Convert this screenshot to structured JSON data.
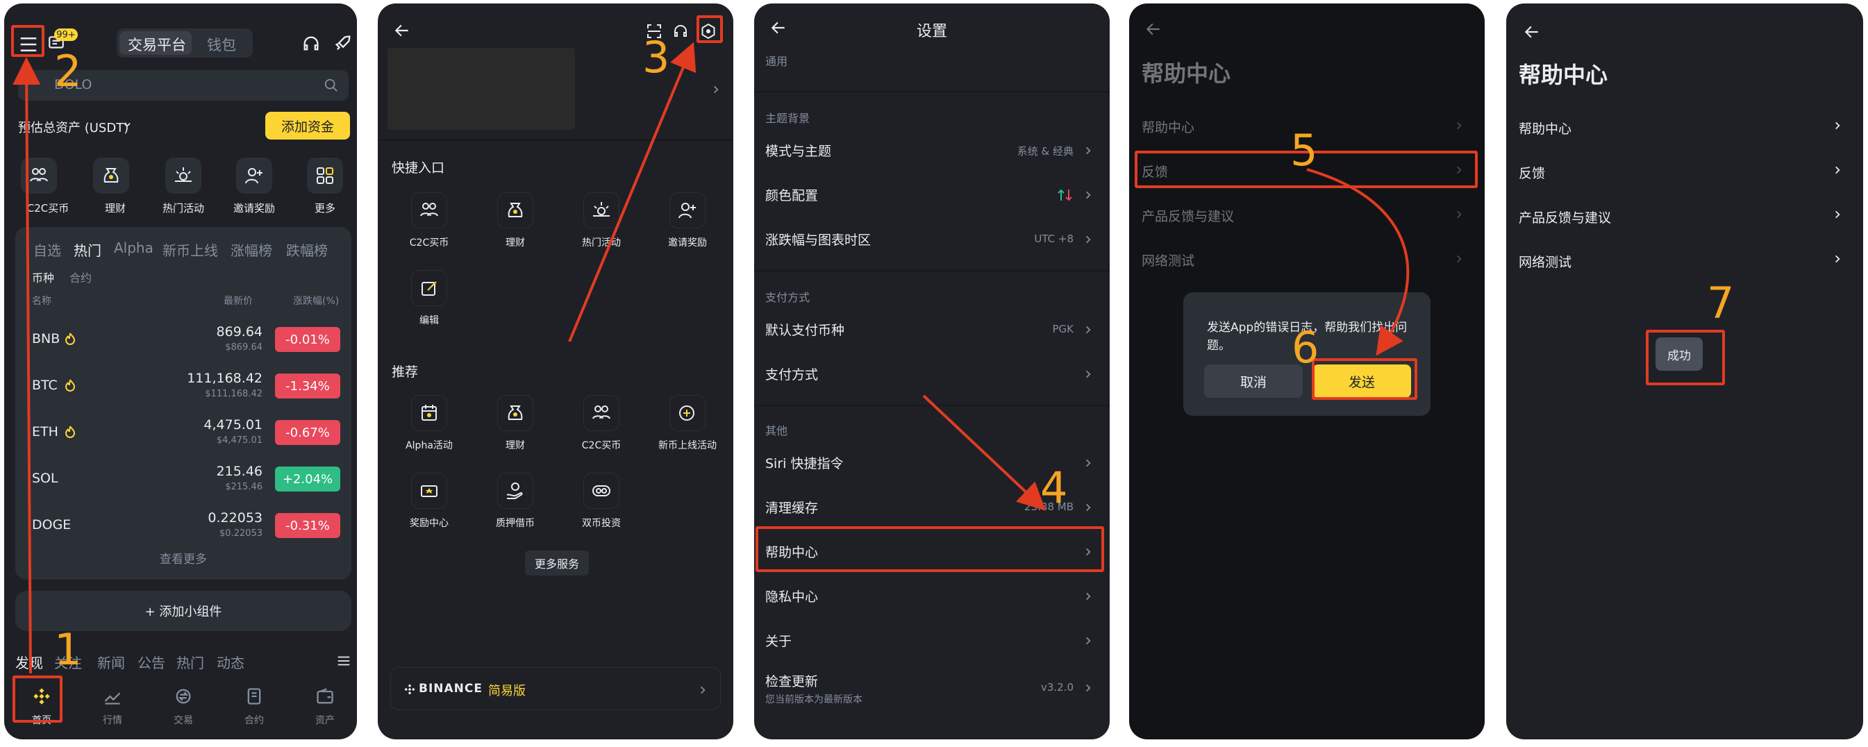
{
  "p1": {
    "badge": "99+",
    "tabs": [
      "交易平台",
      "钱包"
    ],
    "search_placeholder": "DOLO",
    "balance_label": "预估总资产 (USDT)",
    "add_funds": "添加资金",
    "quick": [
      "C2C买币",
      "理财",
      "热门活动",
      "邀请奖励",
      "更多"
    ],
    "market_tabs": [
      "自选",
      "热门",
      "Alpha",
      "新币上线",
      "涨幅榜",
      "跌幅榜"
    ],
    "sub_tabs": [
      "币种",
      "合约"
    ],
    "headers": {
      "name": "名称",
      "price": "最新价",
      "change": "涨跌幅(%)"
    },
    "rows": [
      {
        "sym": "BNB",
        "price": "869.64",
        "usd": "$869.64",
        "chg": "-0.01%",
        "up": false,
        "fire": true
      },
      {
        "sym": "BTC",
        "price": "111,168.42",
        "usd": "$111,168.42",
        "chg": "-1.34%",
        "up": false,
        "fire": true
      },
      {
        "sym": "ETH",
        "price": "4,475.01",
        "usd": "$4,475.01",
        "chg": "-0.67%",
        "up": false,
        "fire": true
      },
      {
        "sym": "SOL",
        "price": "215.46",
        "usd": "$215.46",
        "chg": "+2.04%",
        "up": true,
        "fire": false
      },
      {
        "sym": "DOGE",
        "price": "0.22053",
        "usd": "$0.22053",
        "chg": "-0.31%",
        "up": false,
        "fire": false
      }
    ],
    "view_more": "查看更多",
    "add_widget": "+ 添加小组件",
    "feed_tabs": [
      "发现",
      "关注",
      "新闻",
      "公告",
      "热门",
      "动态"
    ],
    "nav": [
      "首页",
      "行情",
      "交易",
      "合约",
      "资产"
    ]
  },
  "p2": {
    "section_shortcuts": "快捷入口",
    "shortcuts": [
      "C2C买币",
      "理财",
      "热门活动",
      "邀请奖励",
      "编辑"
    ],
    "section_recommend": "推荐",
    "recommend": [
      "Alpha活动",
      "理财",
      "C2C买币",
      "新币上线活动",
      "奖励中心",
      "质押借币",
      "双币投资"
    ],
    "more_services": "更多服务",
    "brand": "BINANCE",
    "lite": "简易版"
  },
  "p3": {
    "title": "设置",
    "general": "通用",
    "sec_theme": "主题背景",
    "mode": "模式与主题",
    "mode_value": "系统 & 经典",
    "color": "颜色配置",
    "chart": "涨跌幅与图表时区",
    "chart_value": "UTC +8",
    "sec_pay": "支付方式",
    "default_currency": "默认支付币种",
    "currency_value": "PGK",
    "pay_method": "支付方式",
    "sec_other": "其他",
    "siri": "Siri 快捷指令",
    "cache": "清理缓存",
    "cache_value": "23.88 MB",
    "help": "帮助中心",
    "privacy": "隐私中心",
    "about": "关于",
    "update": "检查更新",
    "update_sub": "您当前版本为最新版本",
    "version": "v3.2.0"
  },
  "p4": {
    "title": "帮助中心",
    "items": [
      "帮助中心",
      "反馈",
      "产品反馈与建议",
      "网络测试"
    ],
    "dialog_text_1": "发送App的错误日志，帮助我们找出问",
    "dialog_text_2": "题。",
    "cancel": "取消",
    "send": "发送"
  },
  "p5": {
    "title": "帮助中心",
    "items": [
      "帮助中心",
      "反馈",
      "产品反馈与建议",
      "网络测试"
    ],
    "toast": "成功"
  },
  "annotations": [
    "1",
    "2",
    "3",
    "4",
    "5",
    "6",
    "7"
  ],
  "colors": {
    "bg": "#1e2026",
    "card": "#2b2f36",
    "yellow": "#fcd535",
    "red": "#e8495b",
    "green": "#2ebd85",
    "annotation": "#e23b22",
    "step": "#f5a623"
  }
}
